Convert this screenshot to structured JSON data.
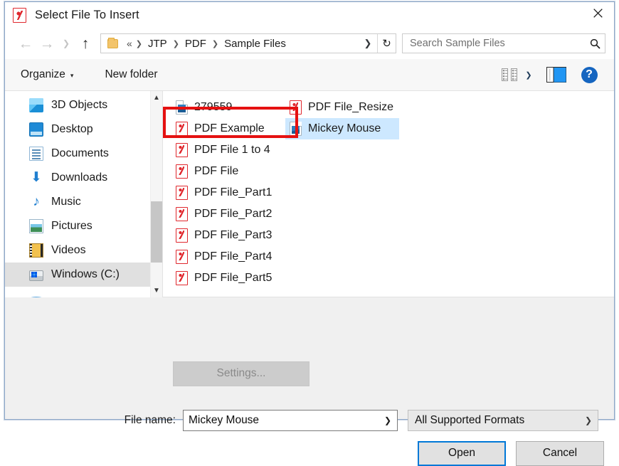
{
  "window": {
    "title": "Select File To Insert",
    "title_icon": "pdf-icon",
    "close_icon": "close-icon"
  },
  "nav": {
    "back_icon": "back-arrow-icon",
    "forward_icon": "forward-arrow-icon",
    "recent_icon": "chevron-down-icon",
    "up_icon": "up-arrow-icon",
    "folder_icon": "folder-icon",
    "breadcrumb_root": "«",
    "breadcrumbs": [
      "JTP",
      "PDF",
      "Sample Files"
    ],
    "separator": "❯",
    "address_dropdown_icon": "chevron-down-icon",
    "refresh_icon": "refresh-icon"
  },
  "search": {
    "placeholder": "Search Sample Files",
    "value": "",
    "icon": "search-icon"
  },
  "command_bar": {
    "organize_label": "Organize",
    "organize_caret": "▾",
    "new_folder_label": "New folder",
    "view_icon": "list-view-icon",
    "view_caret": "❯",
    "preview_pane_icon": "preview-pane-icon",
    "help_label": "?",
    "help_icon": "help-icon"
  },
  "sidebar": {
    "items": [
      {
        "label": "3D Objects",
        "icon": "3d-objects-icon",
        "selected": false
      },
      {
        "label": "Desktop",
        "icon": "desktop-icon",
        "selected": false
      },
      {
        "label": "Documents",
        "icon": "documents-icon",
        "selected": false
      },
      {
        "label": "Downloads",
        "icon": "downloads-icon",
        "selected": false
      },
      {
        "label": "Music",
        "icon": "music-icon",
        "selected": false
      },
      {
        "label": "Pictures",
        "icon": "pictures-icon",
        "selected": false
      },
      {
        "label": "Videos",
        "icon": "videos-icon",
        "selected": false
      },
      {
        "label": "Windows (C:)",
        "icon": "drive-icon",
        "selected": true
      }
    ],
    "scroll_up_icon": "chevron-up-icon",
    "scroll_down_icon": "chevron-down-icon"
  },
  "files": [
    {
      "name": "279559",
      "icon": "image-file-icon",
      "selected": false
    },
    {
      "name": "PDF Example",
      "icon": "pdf-file-icon",
      "selected": false
    },
    {
      "name": "PDF File 1 to 4",
      "icon": "pdf-file-icon",
      "selected": false
    },
    {
      "name": "PDF File",
      "icon": "pdf-file-icon",
      "selected": false
    },
    {
      "name": "PDF File_Part1",
      "icon": "pdf-file-icon",
      "selected": false
    },
    {
      "name": "PDF File_Part2",
      "icon": "pdf-file-icon",
      "selected": false
    },
    {
      "name": "PDF File_Part3",
      "icon": "pdf-file-icon",
      "selected": false
    },
    {
      "name": "PDF File_Part4",
      "icon": "pdf-file-icon",
      "selected": false
    },
    {
      "name": "PDF File_Part5",
      "icon": "pdf-file-icon",
      "selected": false
    },
    {
      "name": "PDF File_Resize",
      "icon": "pdf-file-icon",
      "selected": false
    },
    {
      "name": "Mickey Mouse",
      "icon": "image-file-icon",
      "selected": true
    }
  ],
  "footer": {
    "settings_label": "Settings...",
    "settings_disabled": true,
    "filename_label": "File name:",
    "filename_value": "Mickey Mouse",
    "filename_caret": "❯",
    "filetype_value": "All Supported Formats",
    "filetype_caret": "❯",
    "open_label": "Open",
    "cancel_label": "Cancel"
  },
  "colors": {
    "accent": "#0078d7",
    "selection": "#cde8ff",
    "annotation": "#e51111",
    "pdf_red": "#e0282e",
    "help_blue": "#1565c0",
    "window_border": "#8fa8c8"
  }
}
